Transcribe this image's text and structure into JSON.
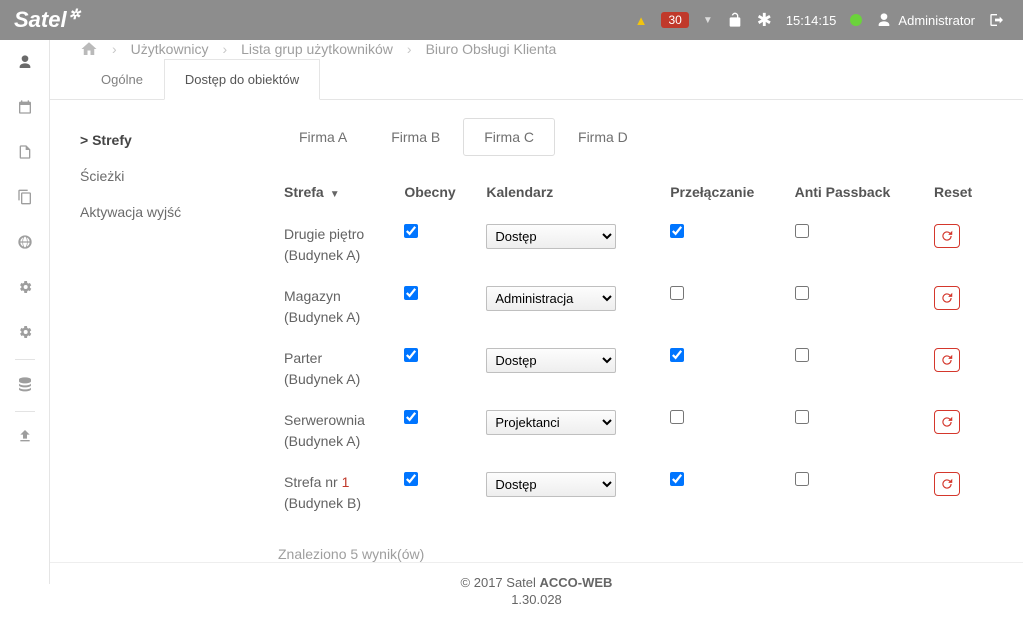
{
  "header": {
    "logo": "Satel",
    "badge": "30",
    "time": "15:14:15",
    "user": "Administrator"
  },
  "breadcrumb": {
    "items": [
      "Użytkownicy",
      "Lista grup użytkowników",
      "Biuro Obsługi Klienta"
    ]
  },
  "tabs": {
    "items": [
      {
        "label": "Ogólne",
        "active": false
      },
      {
        "label": "Dostęp do obiektów",
        "active": true
      }
    ]
  },
  "sidemenu": {
    "items": [
      {
        "label": "Strefy",
        "selected": true,
        "prefix": ">"
      },
      {
        "label": "Ścieżki",
        "selected": false,
        "prefix": ""
      },
      {
        "label": "Aktywacja wyjść",
        "selected": false,
        "prefix": ""
      }
    ]
  },
  "subtabs": {
    "items": [
      {
        "label": "Firma A",
        "active": false
      },
      {
        "label": "Firma B",
        "active": false
      },
      {
        "label": "Firma C",
        "active": true
      },
      {
        "label": "Firma D",
        "active": false
      }
    ]
  },
  "columns": {
    "zone": "Strefa",
    "present": "Obecny",
    "calendar": "Kalendarz",
    "toggle": "Przełączanie",
    "anti": "Anti Passback",
    "reset": "Reset"
  },
  "rows": [
    {
      "zone_l1": "Drugie piętro",
      "zone_l2": "(Budynek A)",
      "present": true,
      "calendar": "Dostęp",
      "toggle": true,
      "anti": false
    },
    {
      "zone_l1": "Magazyn",
      "zone_l2": "(Budynek A)",
      "present": true,
      "calendar": "Administracja",
      "toggle": false,
      "anti": false
    },
    {
      "zone_l1": "Parter",
      "zone_l2": "(Budynek A)",
      "present": true,
      "calendar": "Dostęp",
      "toggle": true,
      "anti": false
    },
    {
      "zone_l1": "Serwerownia",
      "zone_l2": "(Budynek A)",
      "present": true,
      "calendar": "Projektanci",
      "toggle": false,
      "anti": false
    },
    {
      "zone_l1_pre": "Strefa nr ",
      "zone_l1_num": "1",
      "zone_l2": "(Budynek B)",
      "present": true,
      "calendar": "Dostęp",
      "toggle": true,
      "anti": false
    }
  ],
  "results": "Znaleziono 5 wynik(ów)",
  "footer": {
    "copy_pre": "© 2017 Satel ",
    "copy_bold": "ACCO-WEB",
    "version": "1.30.028"
  }
}
